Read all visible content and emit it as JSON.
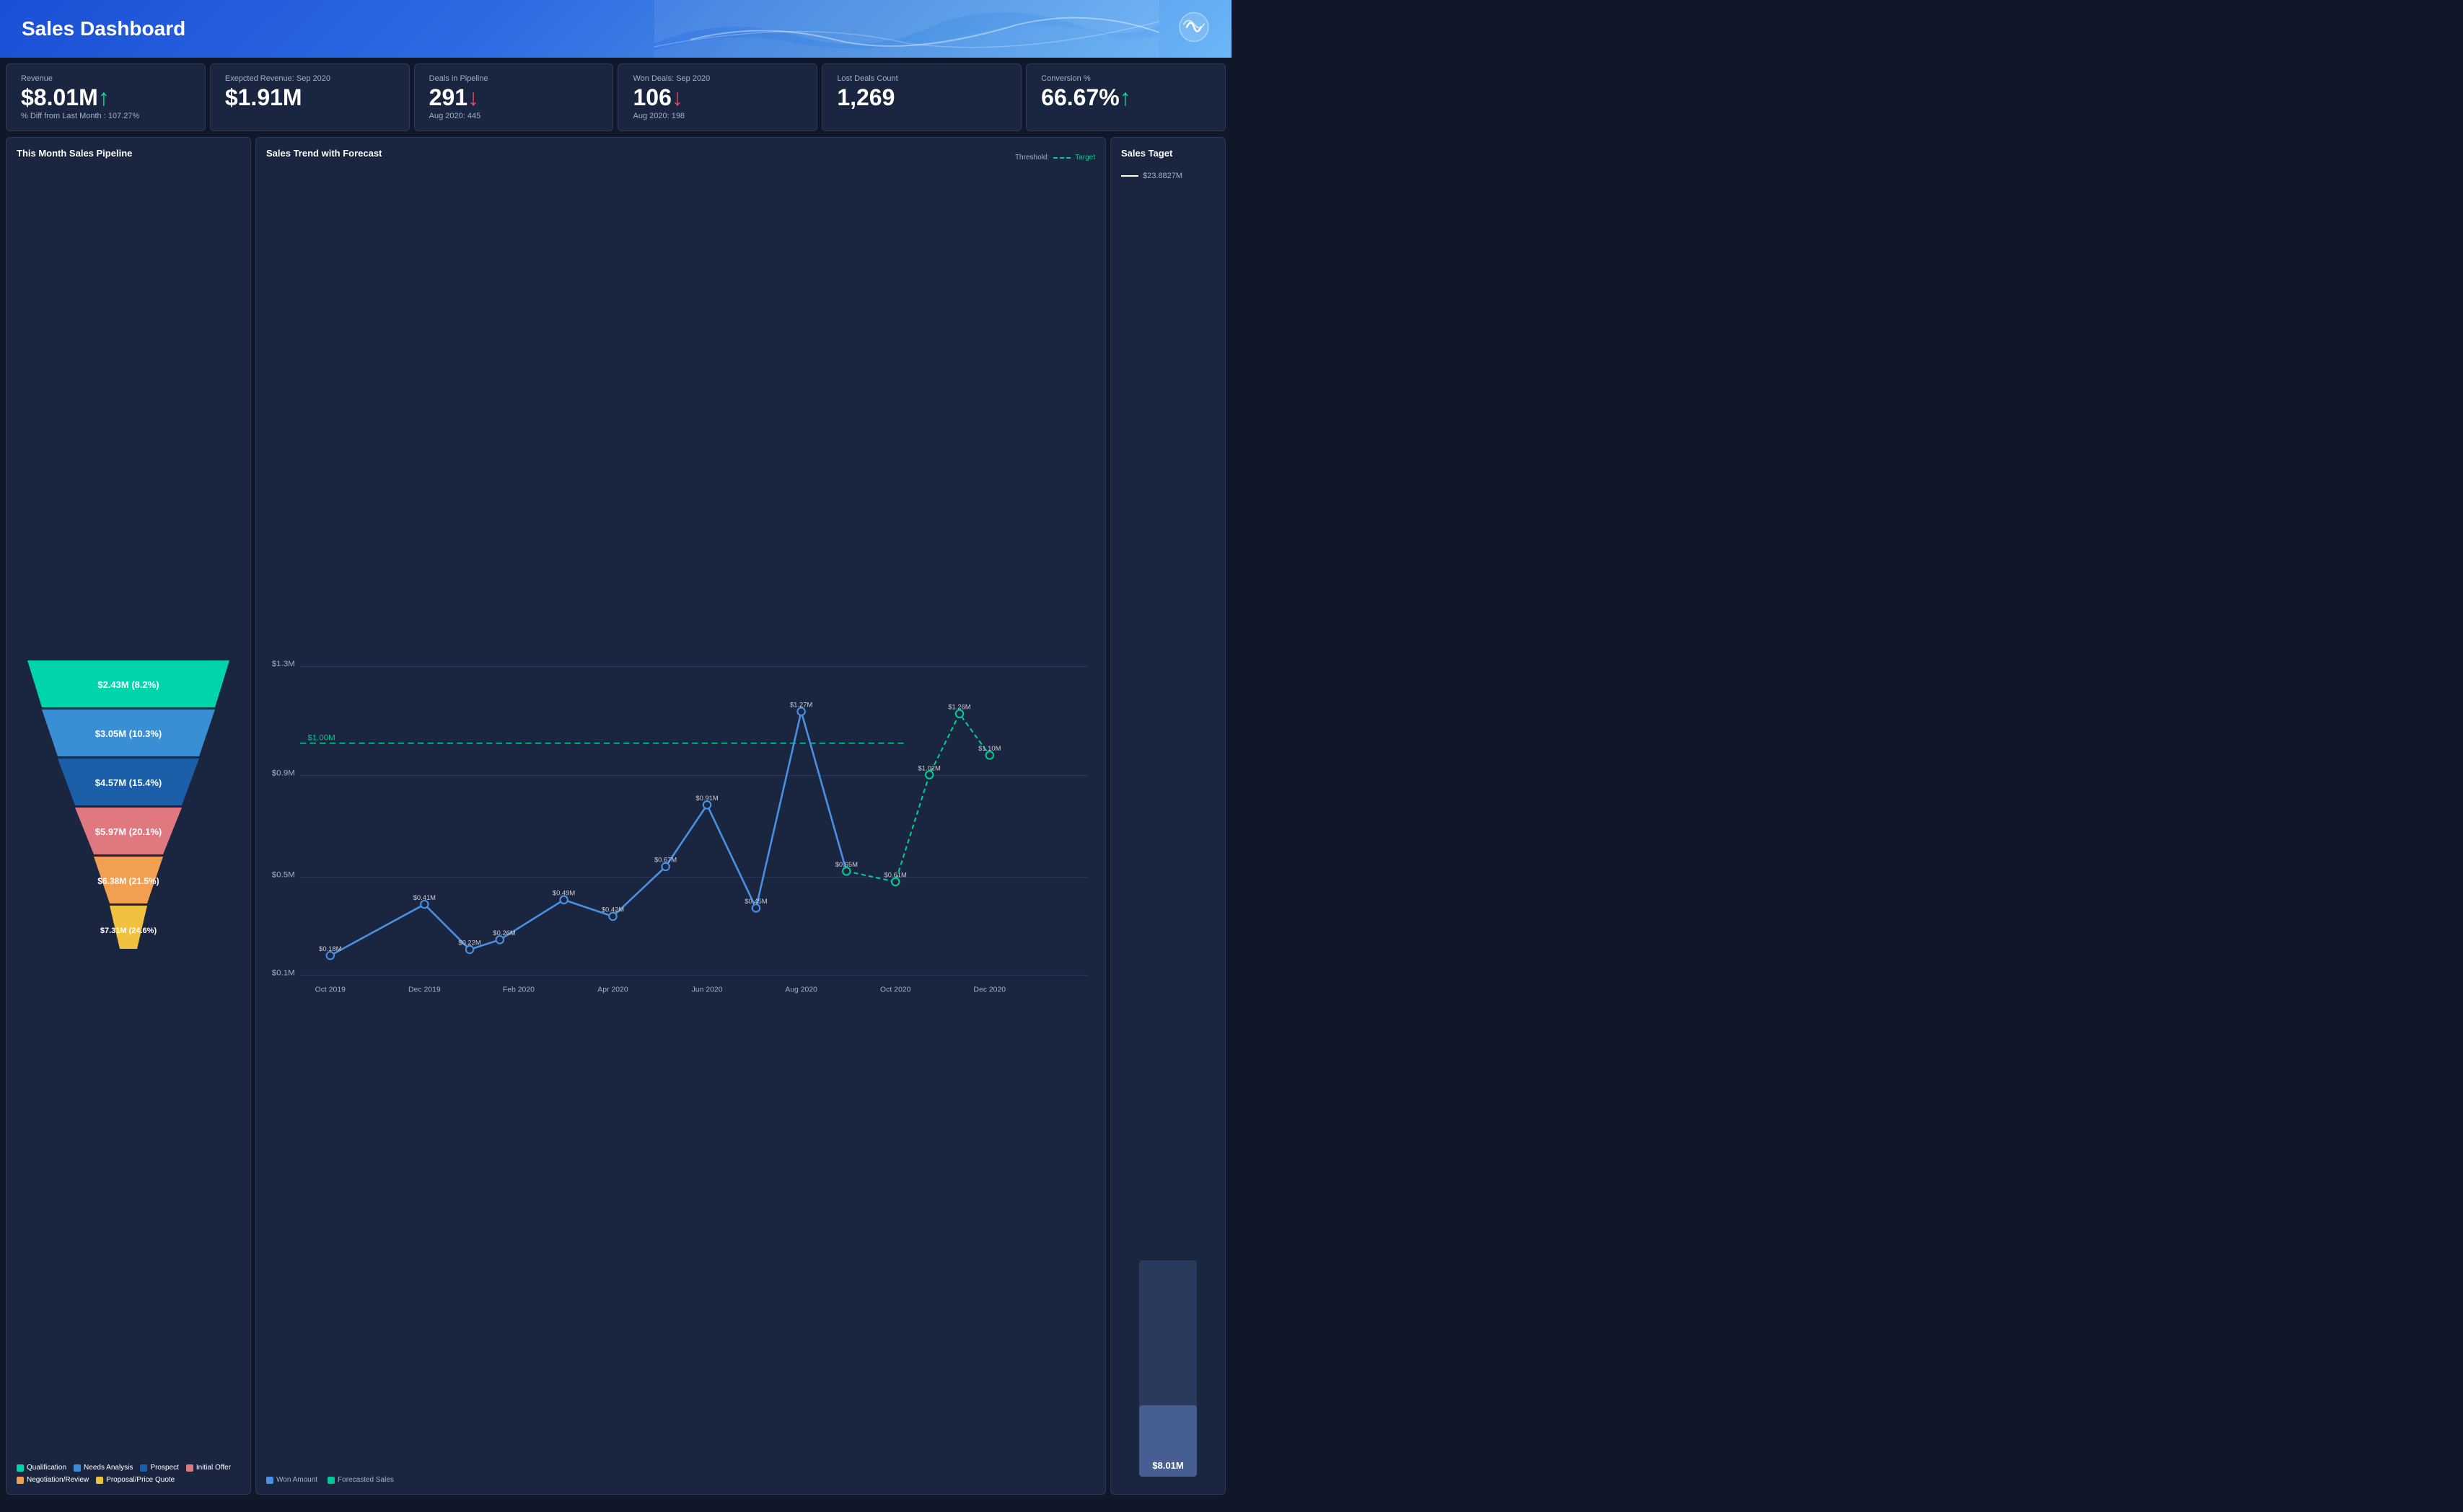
{
  "header": {
    "title": "Sales Dashboard"
  },
  "kpis": [
    {
      "label": "Revenue",
      "value": "$8.01M",
      "arrow": "↑",
      "arrow_type": "up",
      "sub": "% Diff from Last Month : 107.27%"
    },
    {
      "label": "Exepcted Revenue: Sep 2020",
      "value": "$1.91M",
      "arrow": "",
      "arrow_type": "",
      "sub": ""
    },
    {
      "label": "Deals in Pipeline",
      "value": "291",
      "arrow": "↓",
      "arrow_type": "down",
      "sub": "Aug 2020: 445"
    },
    {
      "label": "Won Deals: Sep 2020",
      "value": "106",
      "arrow": "↓",
      "arrow_type": "down",
      "sub": "Aug 2020: 198"
    },
    {
      "label": "Lost Deals Count",
      "value": "1,269",
      "arrow": "",
      "arrow_type": "",
      "sub": ""
    },
    {
      "label": "Conversion %",
      "value": "66.67%",
      "arrow": "↑",
      "arrow_type": "up",
      "sub": ""
    }
  ],
  "funnel": {
    "title": "This Month Sales Pipeline",
    "segments": [
      {
        "label": "$2.43M (8.2%)",
        "color": "#00d4aa",
        "pct": 20
      },
      {
        "label": "$3.05M (10.3%)",
        "color": "#3a8fd4",
        "pct": 30
      },
      {
        "label": "$4.57M (15.4%)",
        "color": "#1a5fa8",
        "pct": 42
      },
      {
        "label": "$5.97M (20.1%)",
        "color": "#e07880",
        "pct": 58
      },
      {
        "label": "$6.38M (21.5%)",
        "color": "#f0a050",
        "pct": 72
      },
      {
        "label": "$7.31M (24.6%)",
        "color": "#f0c040",
        "pct": 88
      }
    ],
    "legend": [
      {
        "label": "Qualification",
        "color": "#00d4aa"
      },
      {
        "label": "Needs Analysis",
        "color": "#3a8fd4"
      },
      {
        "label": "Prospect",
        "color": "#1a5fa8"
      },
      {
        "label": "Initial Offer",
        "color": "#e07880"
      },
      {
        "label": "Negotiation/Review",
        "color": "#f0a050"
      },
      {
        "label": "Proposal/Price Quote",
        "color": "#f0c040"
      }
    ]
  },
  "chart": {
    "title": "Sales Trend with Forecast",
    "threshold_label": "Threshold:",
    "target_label": "Target",
    "legend": [
      {
        "label": "Won Amount",
        "color": "#4a90e2"
      },
      {
        "label": "Forecasted Sales",
        "color": "#00c896"
      }
    ],
    "x_labels": [
      "Oct 2019",
      "Dec 2019",
      "Feb 2020",
      "Apr 2020",
      "Jun 2020",
      "Aug 2020",
      "Oct 2020",
      "Dec 2020"
    ],
    "data_points": [
      {
        "x": 0.04,
        "y": 0.18,
        "label": "$0.18M"
      },
      {
        "x": 0.14,
        "y": 0.41,
        "label": "$0.41M"
      },
      {
        "x": 0.2,
        "y": 0.22,
        "label": "$0.22M"
      },
      {
        "x": 0.26,
        "y": 0.26,
        "label": "$0.26M"
      },
      {
        "x": 0.36,
        "y": 0.49,
        "label": "$0.49M"
      },
      {
        "x": 0.43,
        "y": 0.42,
        "label": "$0.42M"
      },
      {
        "x": 0.5,
        "y": 0.67,
        "label": "$0.67M"
      },
      {
        "x": 0.57,
        "y": 0.91,
        "label": "$0.91M"
      },
      {
        "x": 0.65,
        "y": 0.45,
        "label": "$0.45M"
      },
      {
        "x": 0.71,
        "y": 1.27,
        "label": "$1.27M"
      },
      {
        "x": 0.78,
        "y": 0.65,
        "label": "$0.65M"
      }
    ],
    "forecast_points": [
      {
        "x": 0.78,
        "y": 0.65,
        "label": ""
      },
      {
        "x": 0.84,
        "y": 0.61,
        "label": "$0.61M"
      },
      {
        "x": 0.88,
        "y": 1.02,
        "label": "$1.02M"
      },
      {
        "x": 0.93,
        "y": 1.26,
        "label": "$1.26M"
      },
      {
        "x": 0.97,
        "y": 1.1,
        "label": "$1.10M"
      }
    ],
    "threshold_y": 1.0,
    "threshold_label_val": "$1.00M",
    "y_labels": [
      "$0.1M",
      "$0.5M",
      "$0.9M",
      "$1.3M"
    ]
  },
  "target": {
    "title": "Sales Taget",
    "target_value": "$23.8827M",
    "current_value": "$8.01M",
    "fill_pct": 33
  }
}
